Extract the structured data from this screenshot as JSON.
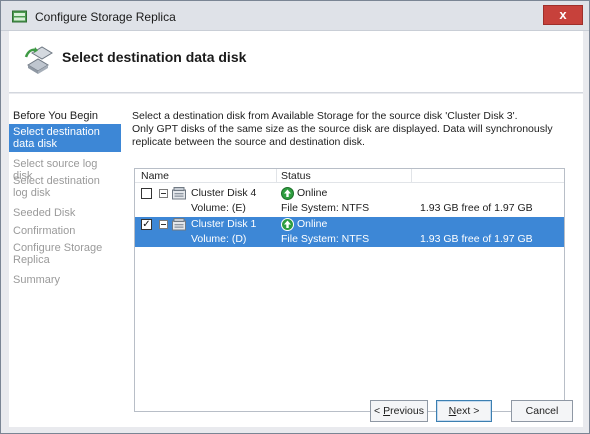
{
  "window": {
    "title": "Configure Storage Replica",
    "close_label": "x"
  },
  "header": {
    "title": "Select destination data disk"
  },
  "nav": {
    "items": [
      {
        "label": "Before You Begin",
        "state": "normal"
      },
      {
        "label": "Select destination data disk",
        "state": "active"
      },
      {
        "label": "Select source log disk",
        "state": "disabled"
      },
      {
        "label": "Select destination log disk",
        "state": "disabled"
      },
      {
        "label": "Seeded Disk",
        "state": "disabled"
      },
      {
        "label": "Confirmation",
        "state": "disabled"
      },
      {
        "label": "Configure Storage Replica",
        "state": "disabled"
      },
      {
        "label": "Summary",
        "state": "disabled"
      }
    ]
  },
  "description": {
    "line1": "Select a destination disk from Available Storage for the source disk 'Cluster Disk 3'.",
    "line2": "Only GPT disks of the same size as the source disk are displayed. Data will synchronously replicate between the source and destination disk."
  },
  "disk_list": {
    "columns": [
      "Name",
      "Status"
    ],
    "rows": [
      {
        "name": "Cluster Disk 4",
        "status": "Online",
        "checked": false,
        "selected": false,
        "volume": "Volume: (E)",
        "filesystem": "File System: NTFS",
        "free": "1.93 GB free of 1.97 GB"
      },
      {
        "name": "Cluster Disk 1",
        "status": "Online",
        "checked": true,
        "selected": true,
        "volume": "Volume: (D)",
        "filesystem": "File System: NTFS",
        "free": "1.93 GB free of 1.97 GB"
      }
    ]
  },
  "buttons": {
    "previous_prefix": "< ",
    "previous_hotkey": "P",
    "previous_rest": "revious",
    "next_hotkey": "N",
    "next_rest": "ext >",
    "cancel": "Cancel"
  },
  "colors": {
    "accent": "#3d87d6",
    "close": "#c7413b",
    "online": "#2e9d3f"
  }
}
